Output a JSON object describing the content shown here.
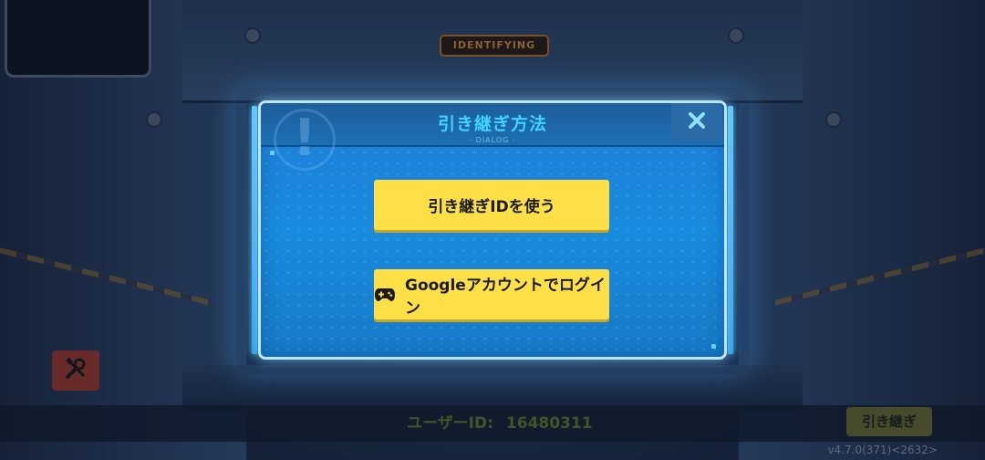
{
  "background": {
    "badge_text": "IDENTIFYING"
  },
  "dialog": {
    "title": "引き継ぎ方法",
    "subtitle": "- DIALOG -",
    "close_label": "✕",
    "buttons": {
      "transfer_id": "引き継ぎIDを使う",
      "google_login": "Googleアカウントでログイン"
    }
  },
  "bottom_bar": {
    "user_id_label": "ユーザーID:",
    "user_id_value": "16480311",
    "transfer_button": "引き継ぎ",
    "version": "v4.7.0(371)<2632>"
  },
  "icons": {
    "tools": "tools-icon",
    "close": "close-icon",
    "gamepad": "gamepad-icon",
    "alert": "exclamation-icon"
  },
  "colors": {
    "dialog_bg": "#1a8bde",
    "title": "#40d3ff",
    "button_yellow": "#fde047",
    "tools_button": "#9b3a30"
  }
}
